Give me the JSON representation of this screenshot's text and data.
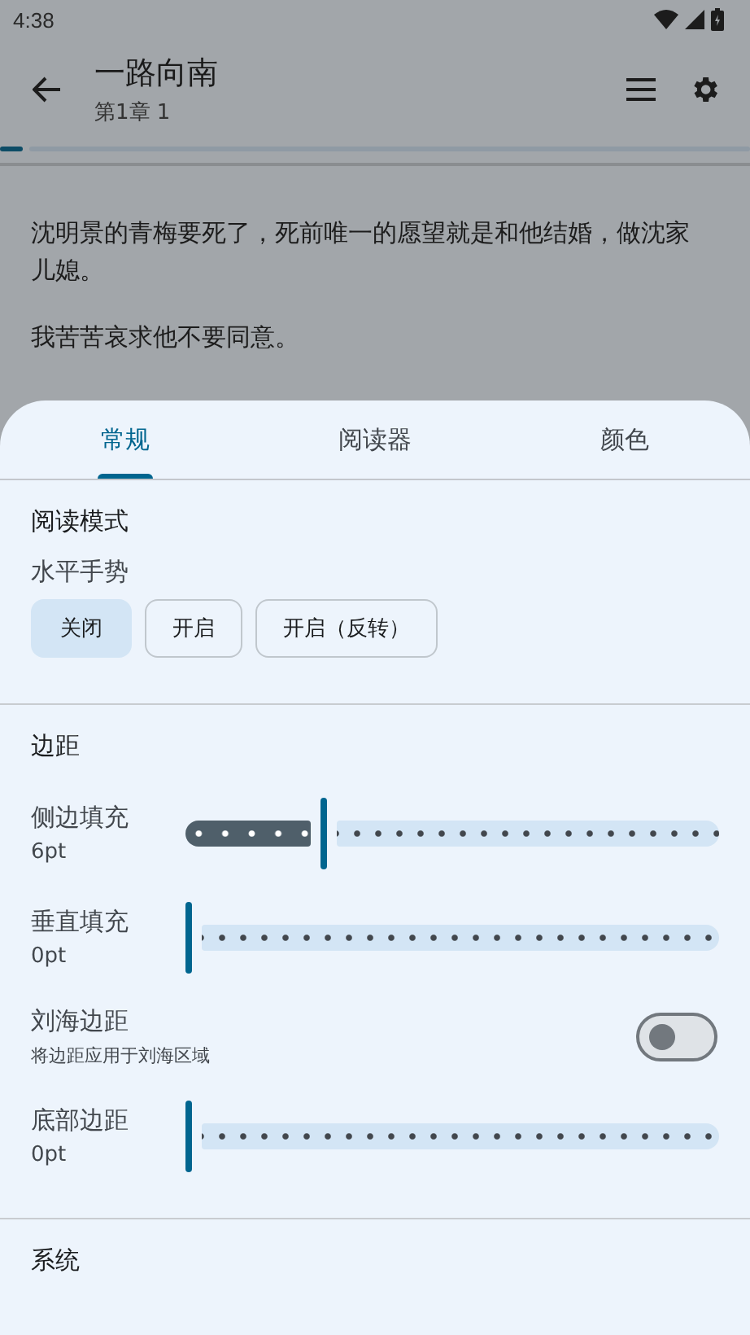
{
  "status_bar": {
    "time": "4:38"
  },
  "app_bar": {
    "title": "一路向南",
    "subtitle": "第1章 1"
  },
  "reading_progress": {
    "level": 0.015
  },
  "content": {
    "paragraphs": [
      "沈明景的青梅要死了，死前唯一的愿望就是和他结婚，做沈家儿媳。",
      "我苦苦哀求他不要同意。"
    ]
  },
  "sheet": {
    "tabs": [
      {
        "label": "常规",
        "selected": true
      },
      {
        "label": "阅读器",
        "selected": false
      },
      {
        "label": "颜色",
        "selected": false
      }
    ],
    "sections": [
      {
        "title": "阅读模式",
        "items": [
          {
            "kind": "choice",
            "label": "水平手势",
            "options": [
              {
                "label": "关闭",
                "selected": true
              },
              {
                "label": "开启",
                "selected": false
              },
              {
                "label": "开启（反转）",
                "selected": false
              }
            ]
          }
        ]
      },
      {
        "title": "边距",
        "items": [
          {
            "kind": "slider",
            "label": "侧边填充",
            "value": "6pt",
            "level": 0.26
          },
          {
            "kind": "slider",
            "label": "垂直填充",
            "value": "0pt",
            "level": 0
          },
          {
            "kind": "toggle",
            "label": "刘海边距",
            "description": "将边距应用于刘海区域",
            "on": false
          },
          {
            "kind": "slider",
            "label": "底部边距",
            "value": "0pt",
            "level": 0
          }
        ]
      },
      {
        "title": "系统"
      }
    ]
  }
}
